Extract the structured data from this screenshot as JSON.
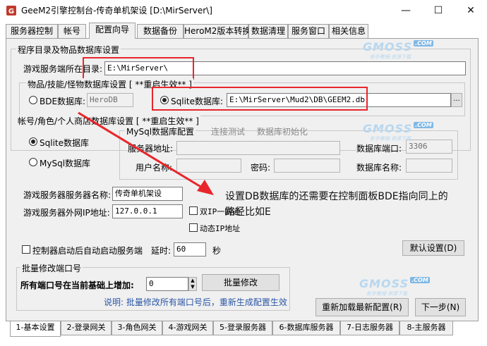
{
  "window": {
    "title": "GeeM2引擎控制台-传奇单机架设 [D:\\MirServer\\]",
    "minimize_glyph": "—",
    "maximize_glyph": "☐",
    "close_glyph": "✕"
  },
  "top_tabs": [
    "服务器控制",
    "帐号",
    "配置向导",
    "数据备份",
    "HeroM2版本转换",
    "数据清理",
    "服务窗口",
    "相关信息"
  ],
  "program_dir_group": {
    "title": "程序目录及物品数据库设置",
    "server_dir_label": "游戏服务端所在目录:",
    "server_dir_value": "E:\\MirServer\\"
  },
  "db_group": {
    "title": "物品/技能/怪物数据库设置 [ **重启生效** ]",
    "bde_label": "BDE数据库:",
    "bde_value": "HeroDB",
    "bde_selected": false,
    "sqlite_label": "Sqlite数据库:",
    "sqlite_value": "E:\\MirServer\\Mud2\\DB\\GEEM2.db",
    "sqlite_selected": true,
    "browse_label": "..."
  },
  "account_db_group": {
    "title": "帐号/角色/个人商店数据库设置 [ **重启生效** ]",
    "sqlite_option": "Sqlite数据库",
    "mysql_option": "MySql数据库",
    "sqlite_selected": true,
    "mysql_config_title": "MySql数据库配置",
    "test_conn": "连接测试",
    "init_db": "数据库初始化",
    "server_addr_label": "服务器地址:",
    "server_addr_value": "",
    "port_label": "数据库端口:",
    "port_value": "3306",
    "username_label": "用户名称:",
    "username_value": "",
    "password_label": "密码:",
    "password_value": "",
    "dbname_label": "数据库名称:",
    "dbname_value": ""
  },
  "server_settings": {
    "name_label": "游戏服务器服务器名称:",
    "name_value": "传奇单机架设",
    "ip_label": "游戏服务器外网IP地址:",
    "ip_value": "127.0.0.1",
    "dual_ip_label": "双IP一网通",
    "dynamic_ip_label": "动态IP地址",
    "autostart_label": "控制器启动后自动启动服务端",
    "delay_label": "延时:",
    "delay_value": "60",
    "seconds_label": "秒",
    "default_btn": "默认设置(D)"
  },
  "port_group": {
    "title": "批量修改端口号",
    "increase_label": "所有端口号在当前基础上增加:",
    "increase_value": "0",
    "modify_btn": "批量修改",
    "hint": "说明: 批量修改所有端口号后，重新生成配置生效"
  },
  "action_buttons": {
    "reload": "重新加载最新配置(R)",
    "next": "下一步(N)"
  },
  "annotation": {
    "note_line1": "设置DB数据库的还需要在控制面板BDE指向同上的",
    "note_line2": "路径比如E"
  },
  "watermark": {
    "text": "GMOSS",
    "badge": ".COM",
    "sub": "新手教程·资源下载"
  },
  "bottom_tabs": [
    "1-基本设置",
    "2-登录网关",
    "3-角色网关",
    "4-游戏网关",
    "5-登录服务器",
    "6-数据库服务器",
    "7-日志服务器",
    "8-主服务器"
  ],
  "colors": {
    "annotation_red": "#e8262b",
    "hint_blue": "#2a56a6",
    "watermark_blue": "#b8d7ef"
  }
}
